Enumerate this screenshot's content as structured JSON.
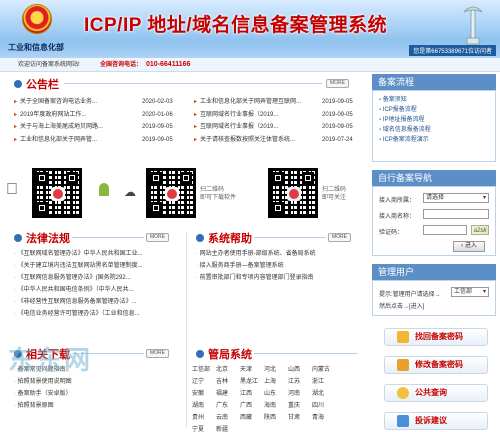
{
  "header": {
    "title": "ICP/IP 地址/域名信息备案管理系统",
    "ministry": "工业和信息化部",
    "visitor_text": "您是第66753389671位访问者"
  },
  "welcome_bar": {
    "welcome": "欢迎访问备案系统网站!",
    "hotline_label": "全国咨询电话：",
    "hotline": "010-66411166"
  },
  "announcements": {
    "title": "公告栏",
    "more": "MORE",
    "left": [
      {
        "text": "关于全国备案咨询电话业务...",
        "date": "2020-02-03"
      },
      {
        "text": "2019年度政府网站工作...",
        "date": "2020-01-06"
      },
      {
        "text": "关于与海上海美尾成地贝网路...",
        "date": "2019-09-05"
      },
      {
        "text": "工业和信息化部关于网弄管...",
        "date": "2019-09-05"
      }
    ],
    "right": [
      {
        "text": "工业和信息化部关于网弄管理互联网...",
        "date": "2019-09-05"
      },
      {
        "text": "互联网域名行业事报（2019...",
        "date": "2019-09-05"
      },
      {
        "text": "互联网域名行业事报（2019...",
        "date": "2019-09-05"
      },
      {
        "text": "关于请核查报数按照关注体管系统...",
        "date": "2019-07-24"
      }
    ]
  },
  "qr_section": {
    "caption1": "扫二维码",
    "caption2": "即可下载软件",
    "caption3": "扫二维码",
    "caption4": "即可关注"
  },
  "laws": {
    "title": "法律法规",
    "more": "MORE",
    "items": [
      "《互联网域名管理办法》中华人民共和国工业...",
      "《关于建立境内违法互联网站黑名单管理制度...",
      "《互联网信息服务管理办法》(国务院292...",
      "《中华人民共和国电信条例》（中华人民共...",
      "《非经营性互联网信息服务备案管理办法》...",
      "《电信业务经营许可管理办法》（工业和信息..."
    ]
  },
  "help": {
    "title": "系统帮助",
    "more": "MORE",
    "items": [
      "网站主办者使用手册-部级系统、省备局系统",
      "接入服务商手册—备案管理系统",
      "前置审批部门和专项内容管理部门登录指南"
    ]
  },
  "downloads": {
    "title": "相关下载",
    "more": "MORE",
    "items": [
      "备案常见问题指南",
      "拍照背景使用说明图",
      "备案助手（安卓版）",
      "拍照背景原图"
    ]
  },
  "provinces": {
    "title": "管局系统",
    "items": [
      "工信部",
      "北京",
      "天津",
      "河北",
      "山西",
      "内蒙古",
      "辽宁",
      "吉林",
      "黑龙江",
      "上海",
      "江苏",
      "浙江",
      "安徽",
      "福建",
      "江西",
      "山东",
      "河南",
      "湖北",
      "湖南",
      "广东",
      "广西",
      "海南",
      "重庆",
      "四川",
      "贵州",
      "云南",
      "西藏",
      "陕西",
      "甘肃",
      "青海",
      "宁夏",
      "新疆"
    ]
  },
  "watermark": "东东网",
  "sidebar": {
    "process_title": "备案流程",
    "process_items": [
      "备案须知",
      "ICP报备流程",
      "IP地址报备流程",
      "域名信息报备流程",
      "ICP备案流程演示"
    ],
    "self_title": "自行备案导航",
    "province_label": "接入商所属：",
    "province_placeholder": "请选择",
    "name_label": "接入商名称：",
    "captcha_label": "验证码：",
    "captcha_value": "a2sk",
    "enter_btn": "进入",
    "admin_title": "管理用户",
    "admin_prompt": "提示:管理用户请选择→",
    "admin_select": "工信部",
    "admin_enter_text": "然后点击→[进入]",
    "buttons": [
      "找回备案密码",
      "修改备案密码",
      "公共查询",
      "投诉建议"
    ]
  },
  "colors": {
    "accent_red": "#c40000",
    "header_blue": "#6faee6",
    "side_head": "#5c8fc7"
  }
}
